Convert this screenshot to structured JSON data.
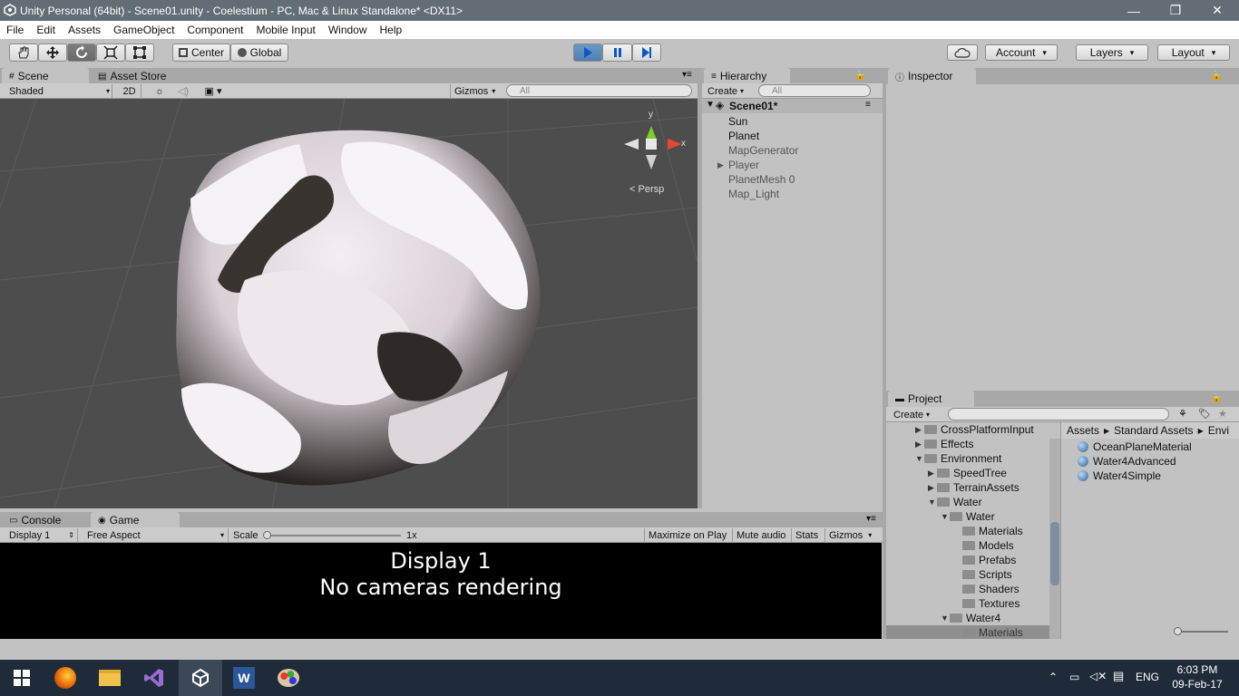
{
  "window": {
    "title": "Unity Personal (64bit) - Scene01.unity - Coelestium - PC, Mac & Linux Standalone* <DX11>",
    "minimize": "—",
    "restore": "❐",
    "close": "✕"
  },
  "menu": [
    "File",
    "Edit",
    "Assets",
    "GameObject",
    "Component",
    "Mobile Input",
    "Window",
    "Help"
  ],
  "toolbar": {
    "pivot": "Center",
    "space": "Global",
    "account": "Account",
    "layers": "Layers",
    "layout": "Layout"
  },
  "scene": {
    "tab_scene": "Scene",
    "tab_asset_store": "Asset Store",
    "shading": "Shaded",
    "mode_2d": "2D",
    "gizmos": "Gizmos",
    "search_placeholder": "All",
    "persp": "Persp",
    "axis_x": "x",
    "axis_y": "y"
  },
  "hierarchy": {
    "tab": "Hierarchy",
    "create": "Create",
    "search_placeholder": "All",
    "scene_name": "Scene01*",
    "items": [
      "Sun",
      "Planet",
      "MapGenerator",
      "Player",
      "PlanetMesh 0",
      "Map_Light"
    ]
  },
  "inspector": {
    "tab": "Inspector"
  },
  "bottom": {
    "tab_console": "Console",
    "tab_game": "Game",
    "display": "Display 1",
    "aspect": "Free Aspect",
    "scale_label": "Scale",
    "scale_value": "1x",
    "maximize": "Maximize on Play",
    "mute": "Mute audio",
    "stats": "Stats",
    "gizmos": "Gizmos",
    "message_line1": "Display 1",
    "message_line2": "No cameras rendering"
  },
  "project": {
    "tab": "Project",
    "create": "Create",
    "breadcrumb": [
      "Assets",
      "Standard Assets",
      "Envi"
    ],
    "tree": [
      "CrossPlatformInput",
      "Effects",
      "Environment",
      "SpeedTree",
      "TerrainAssets",
      "Water",
      "Water",
      "Materials",
      "Models",
      "Prefabs",
      "Scripts",
      "Shaders",
      "Textures",
      "Water4",
      "Materials"
    ],
    "assets": [
      "OceanPlaneMaterial",
      "Water4Advanced",
      "Water4Simple"
    ]
  },
  "taskbar": {
    "lang": "ENG",
    "time": "6:03 PM",
    "date": "09-Feb-17"
  }
}
